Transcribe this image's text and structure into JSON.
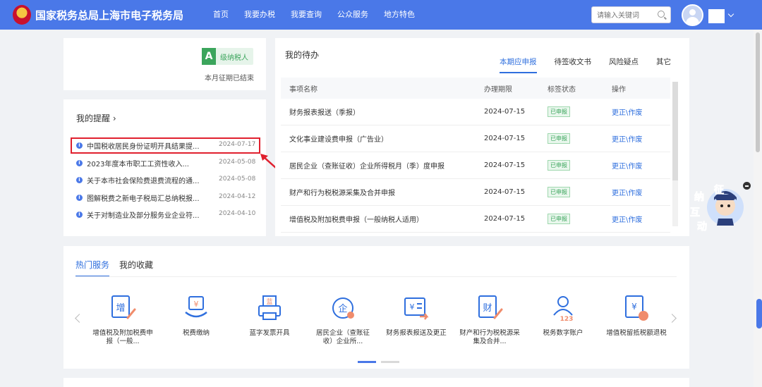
{
  "header": {
    "title": "国家税务总局上海市电子税务局",
    "nav": [
      "首页",
      "我要办税",
      "我要查询",
      "公众服务",
      "地方特色"
    ],
    "search_placeholder": "请输入关键词"
  },
  "taxpayer": {
    "grade_letter": "A",
    "grade_label": "级纳税人",
    "period_status": "本月征期已结束"
  },
  "reminders": {
    "title": "我的提醒 ›",
    "items": [
      {
        "text": "中国税收居民身份证明开具结果提...",
        "date": "2024-07-17"
      },
      {
        "text": "2023年度本市职工工资性收入...",
        "date": "2024-05-08"
      },
      {
        "text": "关于本市社会保险费退费流程的通...",
        "date": "2024-05-08"
      },
      {
        "text": "图解税费之新电子税局汇总纳税报...",
        "date": "2024-04-12"
      },
      {
        "text": "关于对制造业及部分服务业企业符...",
        "date": "2024-04-10"
      }
    ]
  },
  "todo": {
    "title": "我的待办",
    "tabs": [
      "本期应申报",
      "待签收文书",
      "风险疑点",
      "其它"
    ],
    "columns": [
      "事项名称",
      "办理期限",
      "标签状态",
      "操作"
    ],
    "rows": [
      {
        "name": "财务报表报送（季报）",
        "deadline": "2024-07-15",
        "status": "已申报",
        "action": "更正\\作废"
      },
      {
        "name": "文化事业建设费申报（广告业）",
        "deadline": "2024-07-15",
        "status": "已申报",
        "action": "更正\\作废"
      },
      {
        "name": "居民企业（查账征收）企业所得税月（季）度申报",
        "deadline": "2024-07-15",
        "status": "已申报",
        "action": "更正\\作废"
      },
      {
        "name": "财产和行为税税源采集及合并申报",
        "deadline": "2024-07-15",
        "status": "已申报",
        "action": "更正\\作废"
      },
      {
        "name": "增值税及附加税费申报（一般纳税人适用）",
        "deadline": "2024-07-15",
        "status": "已申报",
        "action": "更正\\作废"
      }
    ]
  },
  "services": {
    "tabs": [
      "热门服务",
      "我的收藏"
    ],
    "items": [
      {
        "label": "增值税及附加税费申报（一般...",
        "icon": "vat-declare-icon",
        "glyph": "增"
      },
      {
        "label": "税费缴纳",
        "icon": "tax-payment-icon",
        "glyph": "¥"
      },
      {
        "label": "蓝字发票开具",
        "icon": "invoice-print-icon",
        "glyph": "蓝"
      },
      {
        "label": "居民企业（查账征收）企业所...",
        "icon": "enterprise-tax-icon",
        "glyph": "企"
      },
      {
        "label": "财务报表报送及更正",
        "icon": "financial-report-icon",
        "glyph": "¥"
      },
      {
        "label": "财产和行为税税源采集及合并...",
        "icon": "property-tax-icon",
        "glyph": "财"
      },
      {
        "label": "税务数字账户",
        "icon": "digital-account-icon",
        "glyph": "123"
      },
      {
        "label": "增值税留抵税额退税",
        "icon": "vat-refund-icon",
        "glyph": "¥"
      }
    ]
  },
  "float_widget": {
    "characters": [
      "征",
      "纳",
      "互",
      "动"
    ]
  },
  "colors": {
    "primary": "#4a78e8",
    "link": "#2f6fde",
    "success": "#3ba55c",
    "alert": "#e0202e"
  }
}
